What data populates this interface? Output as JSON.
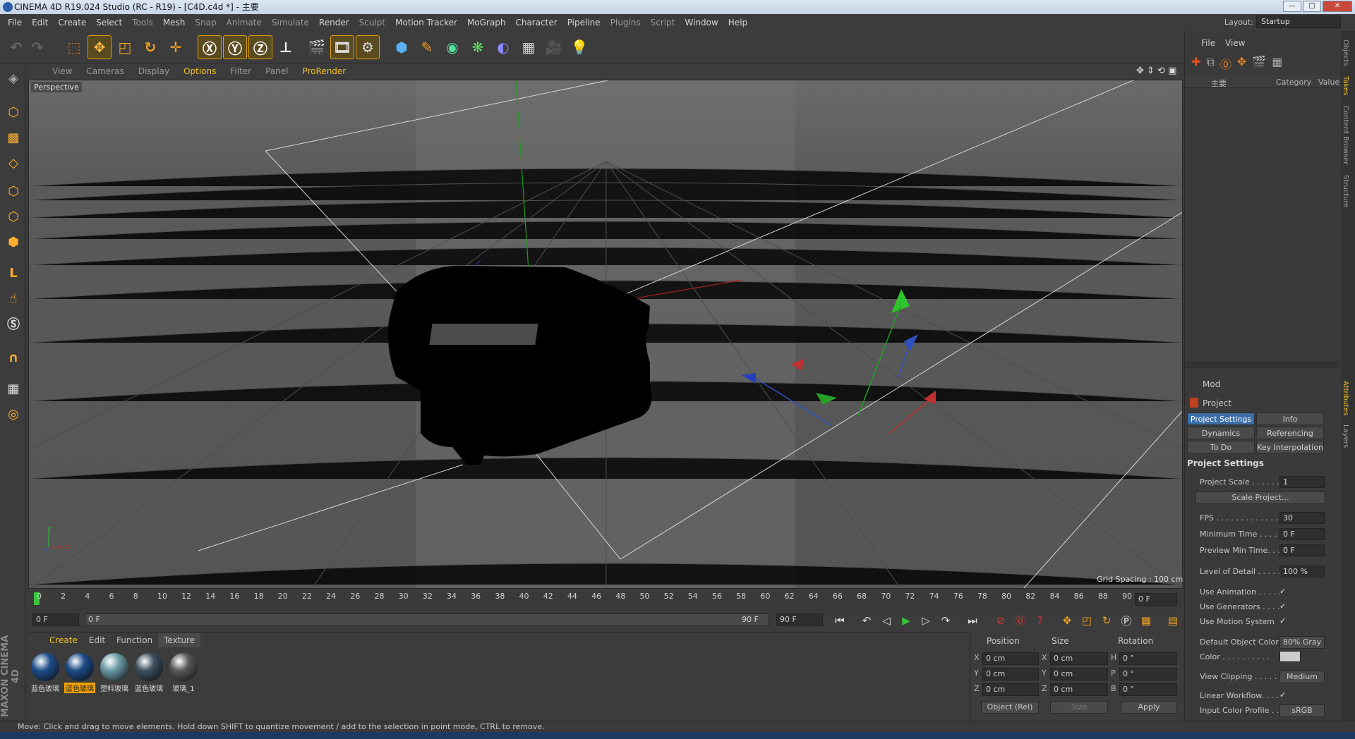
{
  "window": {
    "title": "CINEMA 4D R19.024 Studio (RC - R19) - [C4D.c4d *] - 主要",
    "controls": [
      "—",
      "□",
      "✕"
    ]
  },
  "menu": [
    "File",
    "Edit",
    "Create",
    "Select",
    "Tools",
    "Mesh",
    "Snap",
    "Animate",
    "Simulate",
    "Render",
    "Sculpt",
    "Motion Tracker",
    "MoGraph",
    "Character",
    "Pipeline",
    "Plugins",
    "Script",
    "Window",
    "Help"
  ],
  "layout": {
    "label": "Layout:",
    "value": "Startup"
  },
  "viewport": {
    "menu": [
      "View",
      "Cameras",
      "Display",
      "Options",
      "Filter",
      "Panel",
      "ProRender"
    ],
    "label": "Perspective",
    "grid_spacing": "Grid Spacing : 100 cm",
    "axes": {
      "x": "x",
      "y": "y"
    }
  },
  "timeline": {
    "ticks": [
      "0",
      "2",
      "4",
      "6",
      "8",
      "10",
      "12",
      "14",
      "16",
      "18",
      "20",
      "22",
      "24",
      "26",
      "28",
      "30",
      "32",
      "34",
      "36",
      "38",
      "40",
      "42",
      "44",
      "46",
      "48",
      "50",
      "52",
      "54",
      "56",
      "58",
      "60",
      "62",
      "64",
      "66",
      "68",
      "70",
      "72",
      "74",
      "76",
      "78",
      "80",
      "82",
      "84",
      "86",
      "88",
      "90"
    ],
    "frame_right": "0 F",
    "start": "0 F",
    "slider_left": "0 F",
    "slider_right": "90 F",
    "end": "90 F"
  },
  "materials": {
    "tabs": [
      "Create",
      "Edit",
      "Function",
      "Texture"
    ],
    "items": [
      {
        "label": "蓝色玻璃",
        "color": "#1e4f8a"
      },
      {
        "label": "蓝色玻璃",
        "color": "#1d4a86"
      },
      {
        "label": "塑料玻璃",
        "color": "#6a9aa6"
      },
      {
        "label": "蓝色玻璃",
        "color": "#3d5060"
      },
      {
        "label": "玻璃_1",
        "color": "#5a5a5a"
      }
    ]
  },
  "coords": {
    "headers": [
      "Position",
      "Size",
      "Rotation"
    ],
    "rows": [
      {
        "axis": "X",
        "pos": "0 cm",
        "size_axis": "X",
        "size": "0 cm",
        "rot_axis": "H",
        "rot": "0 °"
      },
      {
        "axis": "Y",
        "pos": "0 cm",
        "size_axis": "Y",
        "size": "0 cm",
        "rot_axis": "P",
        "rot": "0 °"
      },
      {
        "axis": "Z",
        "pos": "0 cm",
        "size_axis": "Z",
        "size": "0 cm",
        "rot_axis": "B",
        "rot": "0 °"
      }
    ],
    "mode": "Object (Rel)",
    "size_mode": "Size",
    "apply": "Apply"
  },
  "objects": {
    "menu": [
      "File",
      "View"
    ],
    "root": "主要",
    "columns": [
      "Category",
      "Value"
    ]
  },
  "attributes": {
    "mode": "Mod",
    "title": "Project",
    "tabs": [
      "Project Settings",
      "Info",
      "Dynamics",
      "Referencing",
      "To Do",
      "Key Interpolation"
    ],
    "section": "Project Settings",
    "rows": [
      {
        "label": "Project Scale . . . . . .",
        "value": "1"
      },
      {
        "label": "FPS . . . . . . . . . . . . . .",
        "value": "30"
      },
      {
        "label": "Minimum Time . . . .",
        "value": "0 F"
      },
      {
        "label": "Preview Min Time. . .",
        "value": "0 F"
      },
      {
        "label": "Level of Detail . . . . .",
        "value": "100 %"
      }
    ],
    "scale_button": "Scale Project...",
    "checks": [
      {
        "label": "Use Animation . . . . .",
        "value": "✓"
      },
      {
        "label": "Use Generators . . . .",
        "value": "✓"
      },
      {
        "label": "Use Motion System",
        "value": "✓"
      }
    ],
    "default_color_label": "Default Object Color",
    "default_color_value": "80% Gray",
    "color_label": "Color . . . . . . . . . .",
    "view_clipping_label": "View Clipping . . . . . .",
    "view_clipping_value": "Medium",
    "linear_workflow_label": "Linear Workflow. . . .",
    "linear_workflow_value": "✓",
    "input_color_label": "Input Color Profile . .",
    "input_color_value": "sRGB"
  },
  "side_tabs": [
    "Objects",
    "Takes",
    "Content Browser",
    "Structure",
    "Attributes",
    "Layers"
  ],
  "status": "Move: Click and drag to move elements. Hold down SHIFT to quantize movement / add to the selection in point mode, CTRL to remove.",
  "logo": "MAXON CINEMA 4D"
}
